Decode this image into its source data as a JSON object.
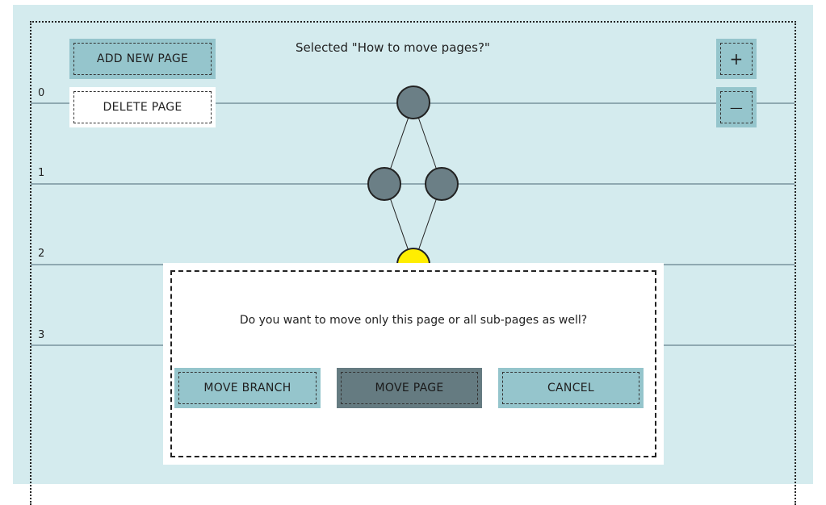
{
  "header": {
    "selected_text": "Selected \"How to move pages?\""
  },
  "toolbar": {
    "add_page_label": "ADD NEW PAGE",
    "delete_page_label": "DELETE PAGE",
    "zoom_in_label": "+",
    "zoom_out_label": "—"
  },
  "levels": [
    "0",
    "1",
    "2",
    "3"
  ],
  "colors": {
    "canvas_bg": "#d4ebee",
    "button_teal": "#95c5cc",
    "button_dark": "#657b81",
    "node_fill": "#6b7f86",
    "node_selected": "#ffee00"
  },
  "dialog": {
    "message": "Do you want to move only this page or all sub-pages as well?",
    "move_branch_label": "MOVE BRANCH",
    "move_page_label": "MOVE PAGE",
    "cancel_label": "CANCEL"
  }
}
